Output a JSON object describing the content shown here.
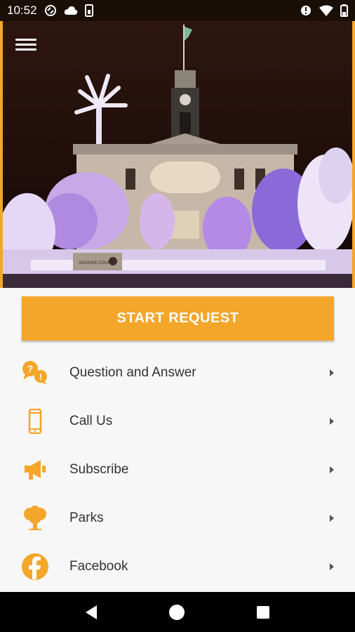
{
  "status_bar": {
    "time": "10:52"
  },
  "hero": {
    "sign_text": "WASHOE COUNTY"
  },
  "start_button": {
    "label": "START REQUEST"
  },
  "menu": {
    "items": [
      {
        "label": "Question and Answer",
        "icon": "question-answer-icon"
      },
      {
        "label": "Call Us",
        "icon": "phone-icon"
      },
      {
        "label": "Subscribe",
        "icon": "megaphone-icon"
      },
      {
        "label": "Parks",
        "icon": "tree-icon"
      },
      {
        "label": "Facebook",
        "icon": "facebook-icon"
      }
    ]
  },
  "colors": {
    "accent": "#f3a62a",
    "text": "#333333",
    "background": "#f7f7f7"
  }
}
